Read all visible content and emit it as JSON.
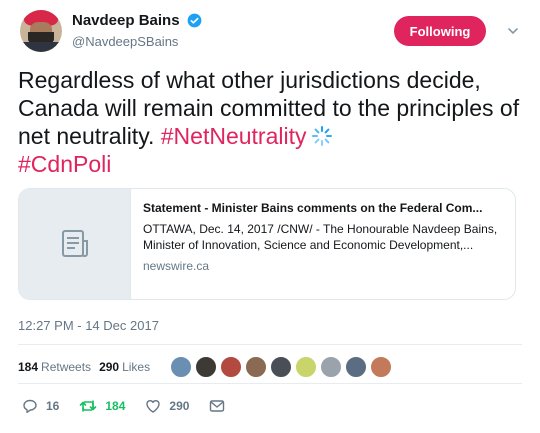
{
  "author": {
    "name": "Navdeep Bains",
    "handle": "@NavdeepSBains",
    "verified": true
  },
  "follow_button": {
    "label": "Following",
    "color": "#e0245e"
  },
  "tweet": {
    "text": "Regardless of what other jurisdictions decide, Canada will remain committed to the principles of net neutrality.",
    "hashtag_1": "#NetNeutrality",
    "hashtag_2": "#CdnPoli",
    "hashtag_color": "#e0245e"
  },
  "card": {
    "title": "Statement - Minister Bains comments on the Federal Com...",
    "description": "OTTAWA, Dec. 14, 2017 /CNW/ - The Honourable Navdeep Bains, Minister of Innovation, Science and Economic Development,...",
    "domain": "newswire.ca",
    "thumb_icon": "document-icon"
  },
  "timestamp": "12:27 PM - 14 Dec 2017",
  "stats": {
    "retweets_count": "184",
    "retweets_label": "Retweets",
    "likes_count": "290",
    "likes_label": "Likes",
    "liker_avatar_colors": [
      "#6b8fb3",
      "#3d3a36",
      "#b34a3f",
      "#8a6a52",
      "#4a4f57",
      "#c9d46a",
      "#9aa3ab",
      "#5a6d82",
      "#c27a5a"
    ]
  },
  "actions": {
    "reply_count": "16",
    "retweet_count": "184",
    "like_count": "290"
  }
}
